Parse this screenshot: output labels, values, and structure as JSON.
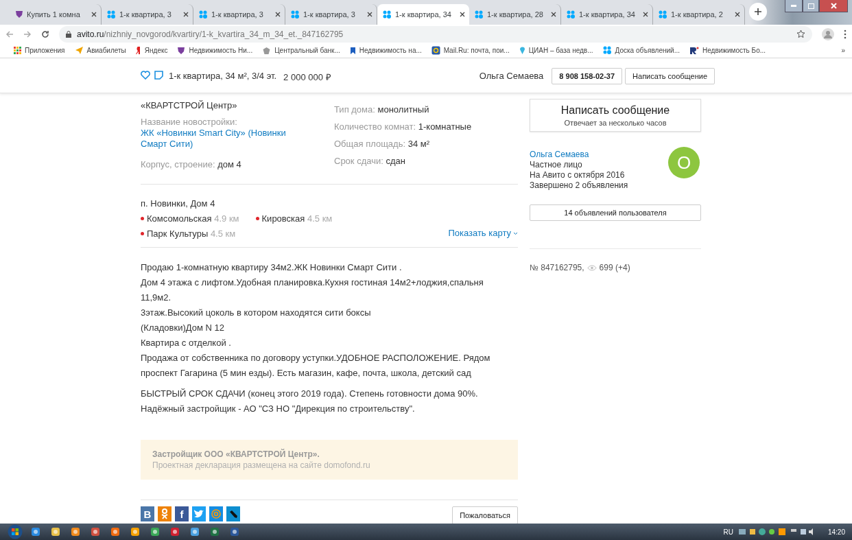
{
  "browser": {
    "tabs": [
      {
        "title": "Купить 1 комна",
        "selected": false
      },
      {
        "title": "1-к квартира, 3",
        "selected": false
      },
      {
        "title": "1-к квартира, 3",
        "selected": false
      },
      {
        "title": "1-к квартира, 3",
        "selected": false
      },
      {
        "title": "1-к квартира, 34",
        "selected": true
      },
      {
        "title": "1-к квартира, 28",
        "selected": false
      },
      {
        "title": "1-к квартира, 34",
        "selected": false
      },
      {
        "title": "1-к квартира, 2",
        "selected": false
      }
    ],
    "address": {
      "host": "avito.ru",
      "path": "/nizhniy_novgorod/kvartiry/1-k_kvartira_34_m_34_et._847162795"
    },
    "bookmarks": [
      "Приложения",
      "Авиабилеты",
      "Яндекс",
      "Недвижимость Ни...",
      "Центральный банк...",
      "Недвижимость на...",
      "Mail.Ru: почта, пои...",
      "ЦИАН – база недв...",
      "Доска объявлений...",
      "Недвижимость Бо..."
    ],
    "more": "»"
  },
  "header": {
    "title": "1-к квартира, 34 м², 3/4 эт.",
    "price": "2 000 000 ₽",
    "seller": "Ольга Семаева",
    "phone": "8 908 158-02-37",
    "message_button": "Написать сообщение"
  },
  "details": {
    "developer": "«КВАРТСТРОЙ Центр»",
    "left": [
      {
        "kind": "link",
        "label": "Название новостройки:",
        "value": "ЖК «Новинки Smart City» (Новинки Смарт Сити)"
      },
      {
        "kind": "inline",
        "label": "Корпус, строение:",
        "value": "дом 4"
      }
    ],
    "right": [
      {
        "label": "Тип дома:",
        "value": "монолитный"
      },
      {
        "label": "Количество комнат:",
        "value": "1-комнатные"
      },
      {
        "label": "Общая площадь:",
        "value": "34 м²"
      },
      {
        "label": "Срок сдачи:",
        "value": "сдан"
      }
    ]
  },
  "location": {
    "address": "п. Новинки, Дом 4",
    "metro": [
      {
        "name": "Комсомольская",
        "distance": "4.9 км"
      },
      {
        "name": "Кировская",
        "distance": "4.5 км"
      },
      {
        "name": "Парк Культуры",
        "distance": "4.5 км"
      }
    ],
    "map_link": "Показать карту"
  },
  "description": [
    [
      "Продаю 1-комнатную квартиру 34м2.ЖК Новинки Смарт Сити .",
      "Дом 4 этажа с лифтом.Удобная планировка.Кухня гостиная 14м2+лоджия,спальня 11,9м2.",
      "3этаж.Высокий цоколь в котором находятся сити боксы",
      "(Кладовки)Дом N 12",
      "Квартира с отделкой .",
      "Продажа от собственника по договору уступки.УДОБНОЕ РАСПОЛОЖЕНИЕ. Рядом проспект Гагарина (5 мин езды). Есть магазин, кафе, почта, школа, детский сад"
    ],
    [
      "БЫСТРЫЙ СРОК СДАЧИ (конец этого 2019 года). Степень готовности дома 90%.",
      "Надёжный застройщик - АО \"СЗ НО \"Дирекция по строительству\"."
    ]
  ],
  "notice": {
    "title": "Застройщик ООО «КВАРТСТРОЙ Центр».",
    "text": "Проектная декларация размещена на сайте domofond.ru"
  },
  "share": [
    {
      "kind": "vk",
      "glyph": "В"
    },
    {
      "kind": "ok"
    },
    {
      "kind": "fb",
      "glyph": "f"
    },
    {
      "kind": "tw"
    },
    {
      "kind": "mail"
    },
    {
      "kind": "lj"
    }
  ],
  "complain_button": "Пожаловаться",
  "sidebar": {
    "message_button": {
      "title": "Написать сообщение",
      "subtitle": "Отвечает за несколько часов"
    },
    "seller": {
      "name": "Ольга Семаева",
      "avatar_letter": "О",
      "lines": [
        "Частное лицо",
        "На Авито с октября 2016",
        "Завершено 2 объявления"
      ]
    },
    "listings_button": "14 объявлений пользователя",
    "ad_number": "№ 847162795,",
    "views": "699 (+4)"
  },
  "taskbar": {
    "language": "RU",
    "time": "14:20"
  }
}
